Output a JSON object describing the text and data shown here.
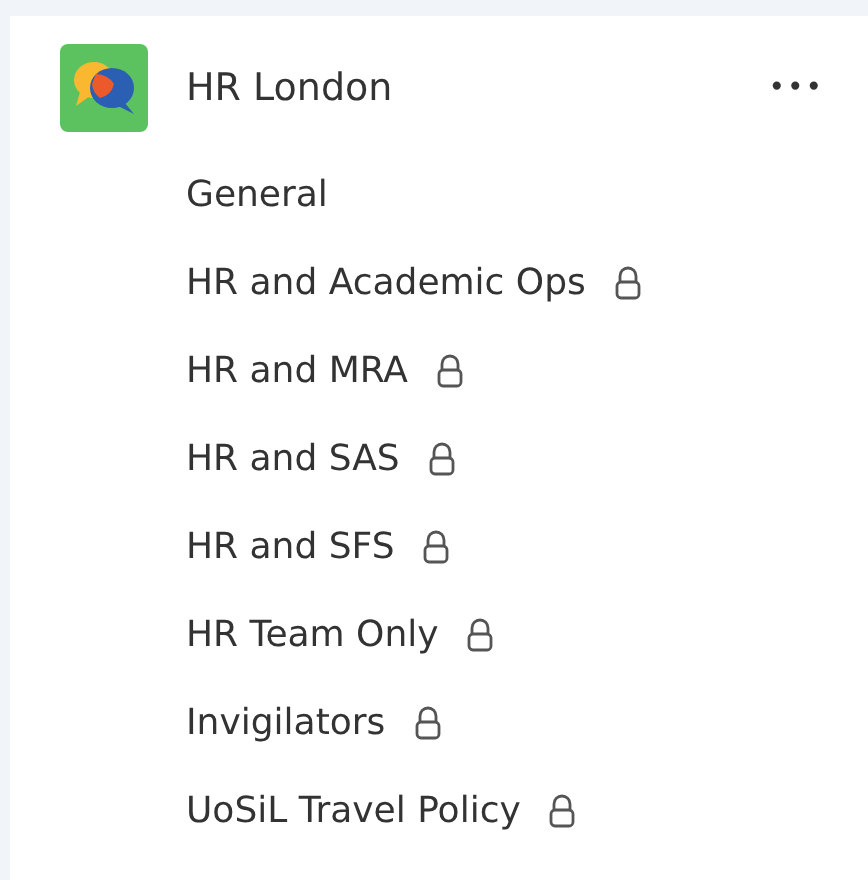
{
  "team": {
    "name": "HR London",
    "more": "•••"
  },
  "channels": [
    {
      "name": "General",
      "private": false
    },
    {
      "name": "HR and Academic Ops",
      "private": true
    },
    {
      "name": "HR and MRA",
      "private": true
    },
    {
      "name": "HR and SAS",
      "private": true
    },
    {
      "name": "HR and SFS",
      "private": true
    },
    {
      "name": "HR Team Only",
      "private": true
    },
    {
      "name": "Invigilators",
      "private": true
    },
    {
      "name": "UoSiL Travel Policy",
      "private": true
    }
  ]
}
